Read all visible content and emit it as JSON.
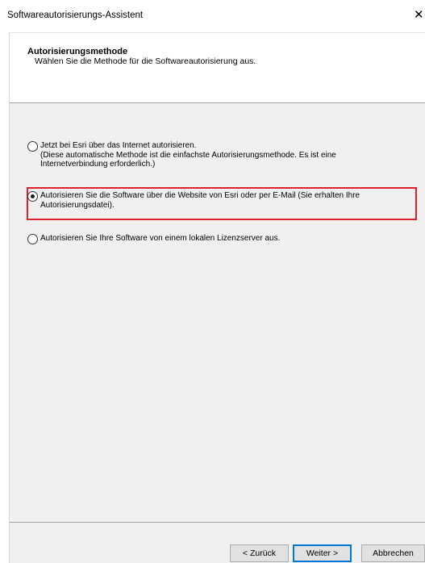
{
  "window": {
    "title": "Softwareautorisierungs-Assistent",
    "close_glyph": "✕"
  },
  "header": {
    "title": "Autorisierungsmethode",
    "subtitle": "Wählen Sie die Methode für die Softwareautorisierung aus."
  },
  "options": [
    {
      "lines": [
        "Jetzt bei Esri über das Internet autorisieren.",
        "(Diese automatische Methode ist die einfachste Autorisierungsmethode. Es ist eine",
        "Internetverbindung erforderlich.)"
      ],
      "selected": false
    },
    {
      "lines": [
        "Autorisieren Sie die Software über die Website von Esri oder per E-Mail (Sie erhalten Ihre",
        "Autorisierungsdatei)."
      ],
      "selected": true,
      "highlight_color": "#e0202a"
    },
    {
      "lines": [
        "Autorisieren Sie Ihre Software von einem lokalen Lizenzserver aus."
      ],
      "selected": false
    }
  ],
  "buttons": {
    "back": "< Zurück",
    "next": "Weiter >",
    "cancel": "Abbrechen"
  }
}
